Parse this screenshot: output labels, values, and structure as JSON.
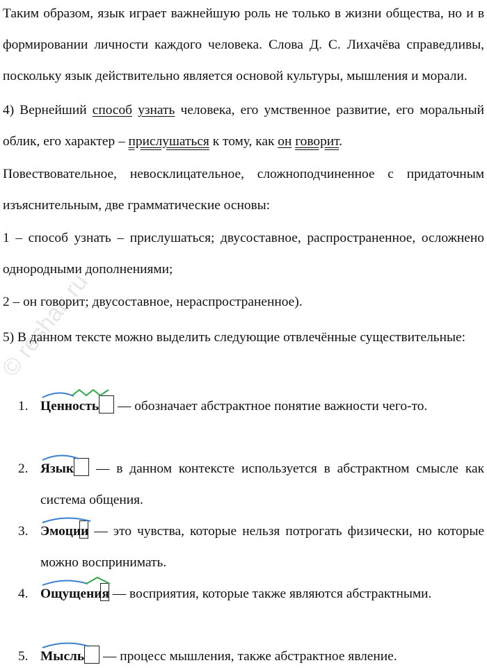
{
  "para1": "Таким образом, язык играет важнейшую роль не только в жизни общества, но и в формировании личности каждого человека. Слова Д. С. Лихачёва справедливы, поскольку язык действительно является основой культуры, мышления и морали.",
  "para2": {
    "p1": "4) Вернейший ",
    "w1": "способ",
    "sp1": " ",
    "w2": "узнать",
    "p2": " человека, его умственное развитие, его моральный облик, его характер – ",
    "w3": "прислушаться",
    "p3": " к тому, как ",
    "w4": "он",
    "sp2": " ",
    "w5": "говорит",
    "p4": "."
  },
  "para3": "Повествовательное, невосклицательное, сложноподчиненное с придаточным изъяснительным, две грамматические основы:",
  "para4": "1 – способ узнать – прислушаться; двусоставное, распространенное, осложнено однородными дополнениями;",
  "para5": "2 – он говорит; двусоставное, нераспространенное).",
  "para6": "5) В данном тексте можно выделить следующие отвлечённые существительные:",
  "watermark": "reshak.ru",
  "list": [
    {
      "num": "1.",
      "word": "Ценность",
      "text": " — обозначает абстрактное понятие важности чего-то."
    },
    {
      "num": "2.",
      "word": "Язык",
      "text": " — в данном контексте используется в абстрактном смысле как система общения."
    },
    {
      "num": "3.",
      "word": "Эмоции",
      "text": " — это чувства, которые нельзя потрогать физически, но которые можно воспринимать."
    },
    {
      "num": "4.",
      "word": "Ощущения",
      "text": " — восприятия, которые также являются абстрактными."
    },
    {
      "num": "5.",
      "word": "Мысль",
      "text": " — процесс мышления, также абстрактное явление."
    }
  ],
  "colors": {
    "root_arc": "#3a7fd0",
    "suffix_mark": "#2ea84a"
  }
}
